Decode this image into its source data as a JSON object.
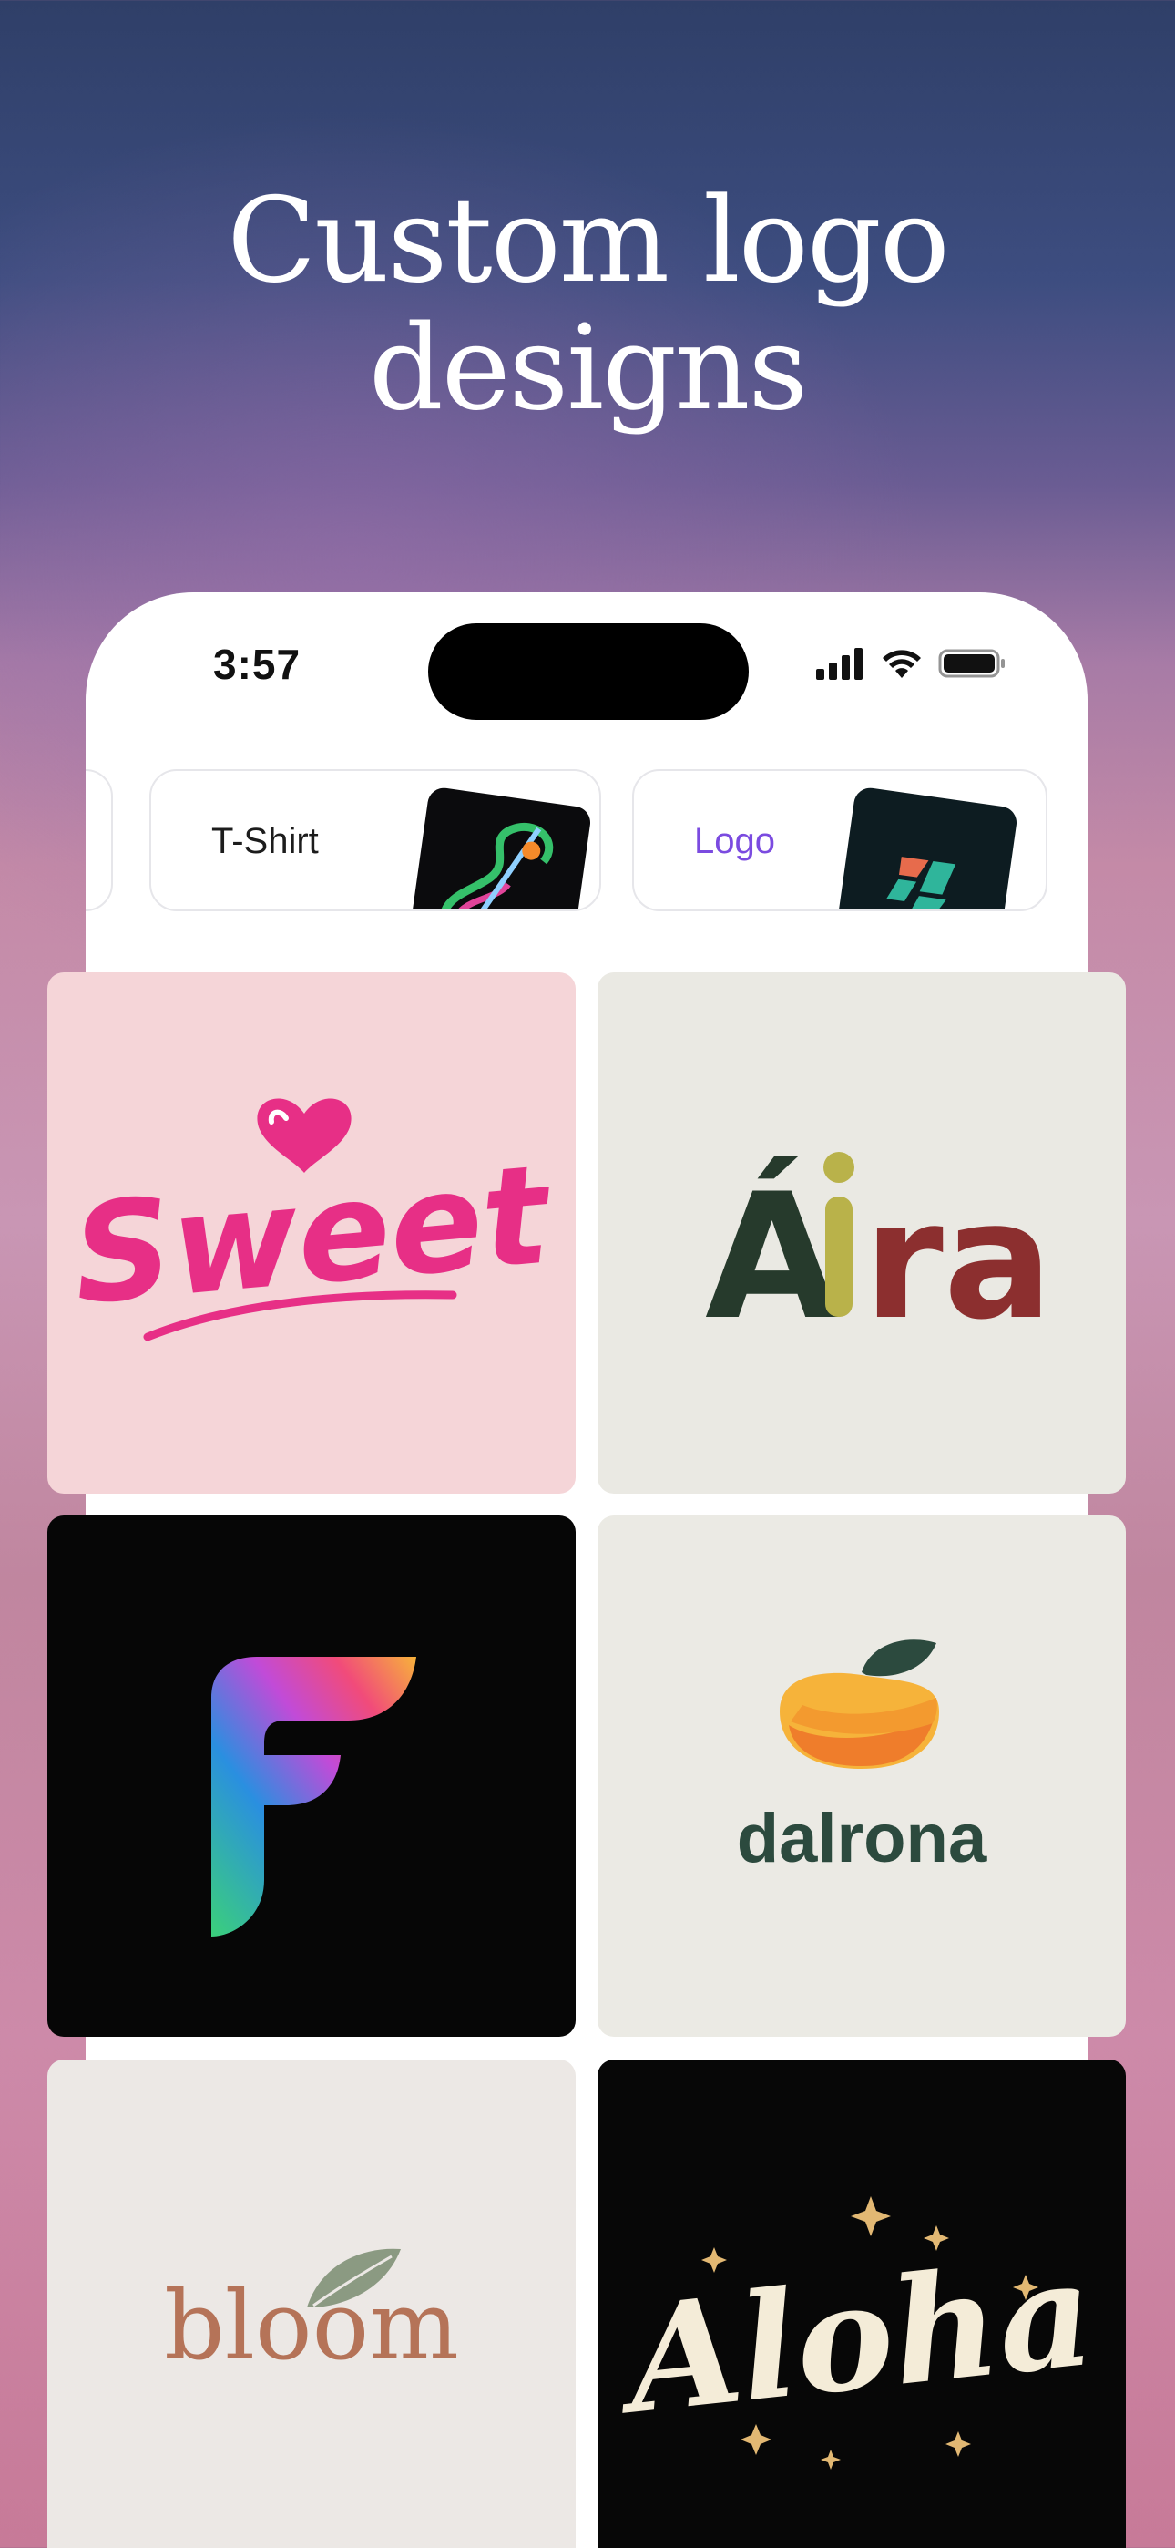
{
  "headline": {
    "line1": "Custom logo",
    "line2": "designs"
  },
  "status_bar": {
    "time": "3:57",
    "icons": [
      "signal-icon",
      "wifi-icon",
      "battery-icon"
    ]
  },
  "categories": [
    {
      "label": "T-Shirt",
      "selected": false
    },
    {
      "label": "Logo",
      "selected": true
    }
  ],
  "logos": [
    {
      "name": "Sweet",
      "background": "#f5d5d8",
      "color": "#e72f86"
    },
    {
      "name": "Áira",
      "background": "#eae9e3",
      "colors": [
        "#263a2c",
        "#b9b24a",
        "#8c2f2f"
      ]
    },
    {
      "name": "F",
      "background": "#060606"
    },
    {
      "name": "dalrona",
      "background": "#ebeae4",
      "color": "#2c4a3e"
    },
    {
      "name": "bloom",
      "background": "#ece8e5",
      "color": "#b57358"
    },
    {
      "name": "Aloha",
      "background": "#070707",
      "color": "#f4ecd8",
      "accent": "#e2b873"
    }
  ],
  "colors": {
    "accent_purple": "#7b4be0"
  }
}
